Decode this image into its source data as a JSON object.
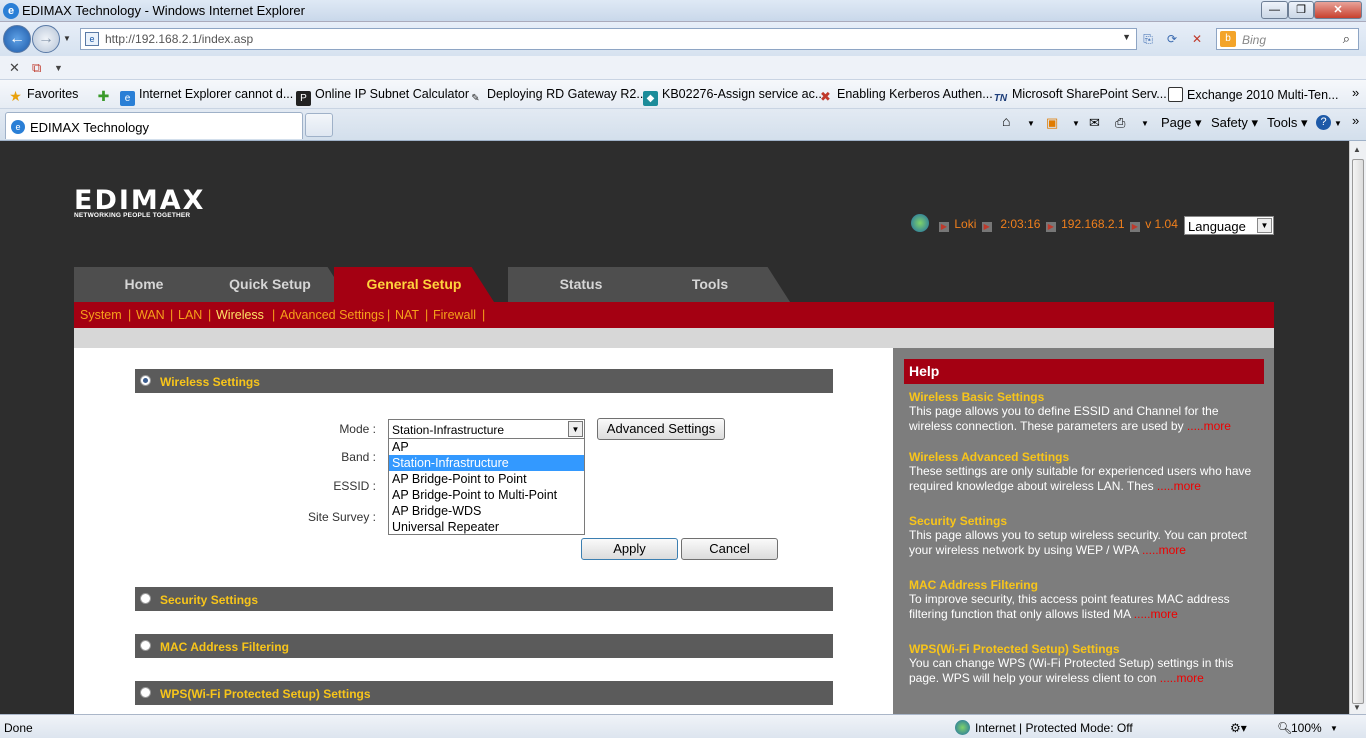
{
  "window": {
    "title": "EDIMAX Technology - Windows Internet Explorer"
  },
  "address_bar": {
    "url": "http://192.168.2.1/index.asp",
    "search_placeholder": "Bing"
  },
  "favorites": {
    "label": "Favorites",
    "items": [
      "Internet Explorer cannot d...",
      "Online IP Subnet Calculator",
      "Deploying RD Gateway R2...",
      "KB02276-Assign service ac...",
      "Enabling Kerberos Authen...",
      "Microsoft SharePoint Serv...",
      "Exchange 2010 Multi-Ten..."
    ]
  },
  "tab": {
    "label": "EDIMAX Technology"
  },
  "toolbar": {
    "page": "Page",
    "safety": "Safety",
    "tools": "Tools"
  },
  "router": {
    "logo": "EDIMAX",
    "tagline": "NETWORKING PEOPLE TOGETHER",
    "status": {
      "user": "Loki",
      "time": "2:03:16",
      "ip": "192.168.2.1",
      "version": "v 1.04"
    },
    "language": "Language",
    "main_tabs": [
      "Home",
      "Quick Setup",
      "General Setup",
      "Status",
      "Tools"
    ],
    "active_tab": "General Setup",
    "subnav": [
      "System",
      "WAN",
      "LAN",
      "Wireless",
      "Advanced Settings",
      "NAT",
      "Firewall"
    ],
    "active_subnav": "Wireless",
    "sections": {
      "wireless": "Wireless Settings",
      "security": "Security Settings",
      "mac": "MAC Address Filtering",
      "wps": "WPS(Wi-Fi Protected Setup) Settings"
    },
    "form": {
      "mode_label": "Mode :",
      "band_label": "Band :",
      "essid_label": "ESSID :",
      "survey_label": "Site Survey :",
      "mode_value": "Station-Infrastructure",
      "mode_options": [
        "AP",
        "Station-Infrastructure",
        "AP Bridge-Point to Point",
        "AP Bridge-Point to Multi-Point",
        "AP Bridge-WDS",
        "Universal Repeater"
      ],
      "advanced_button": "Advanced Settings",
      "apply_button": "Apply",
      "cancel_button": "Cancel"
    },
    "help": {
      "title": "Help",
      "more": ".....more",
      "entries": [
        {
          "title": "Wireless Basic Settings",
          "text": "This page allows you to define ESSID and Channel for the wireless connection. These parameters are used by "
        },
        {
          "title": "Wireless Advanced Settings",
          "text": "These settings are only suitable for experienced users who have required knowledge about wireless LAN. Thes "
        },
        {
          "title": "Security Settings",
          "text": "This page allows you to setup wireless security. You can protect your wireless network by using WEP / WPA "
        },
        {
          "title": "MAC Address Filtering",
          "text": "To improve security, this access point features MAC address filtering function that only allows listed MA "
        },
        {
          "title": "WPS(Wi-Fi Protected Setup) Settings",
          "text": "You can change WPS (Wi-Fi Protected Setup) settings in this page. WPS will help your wireless client to con "
        }
      ]
    }
  },
  "statusbar": {
    "left": "Done",
    "zone": "Internet | Protected Mode: Off",
    "zoom": "100%"
  }
}
